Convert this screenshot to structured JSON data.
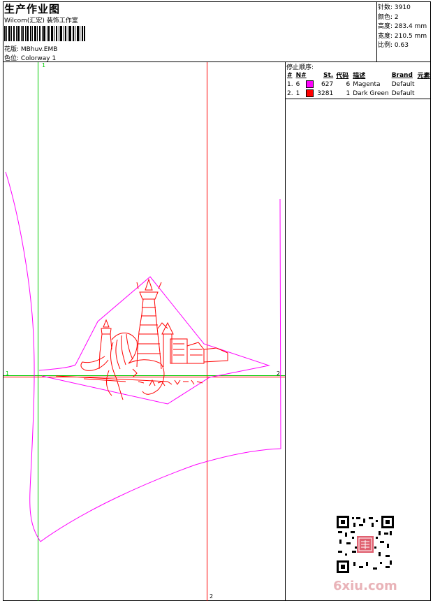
{
  "header": {
    "title": "生产作业图",
    "subtitle": "Wilcom(汇宏) 装饰工作室",
    "design_label": "花版:",
    "design_value": "MBhuv.EMB",
    "colorway_label": "色位:",
    "colorway_value": "Colorway 1"
  },
  "stats": [
    {
      "label": "针数:",
      "value": "3910"
    },
    {
      "label": "颜色:",
      "value": "2"
    },
    {
      "label": "高度:",
      "value": "283.4 mm"
    },
    {
      "label": "宽度:",
      "value": "210.5 mm"
    },
    {
      "label": "比例:",
      "value": "0.63"
    }
  ],
  "stop_sequence": {
    "title": "停止顺序:",
    "columns": [
      "#",
      "N#",
      "St.",
      "代码",
      "描述",
      "Brand",
      "元素"
    ],
    "rows": [
      {
        "num": "1.",
        "n": "6",
        "color": "#ff00ff",
        "stitches": "627",
        "code": "6",
        "desc": "Magenta",
        "brand": "Default"
      },
      {
        "num": "2.",
        "n": "1",
        "color": "#ff0000",
        "stitches": "3281",
        "code": "1",
        "desc": "Dark Green",
        "brand": "Default"
      }
    ]
  },
  "axes": {
    "v1_top": "1",
    "v2_bottom": "2",
    "h_left": "1",
    "h_right": "2"
  },
  "colors": {
    "magenta": "#ff00ff",
    "red": "#ff0000",
    "green": "#00cc00"
  },
  "watermark": "6xiu.com",
  "qr_stamp": "QR-code"
}
